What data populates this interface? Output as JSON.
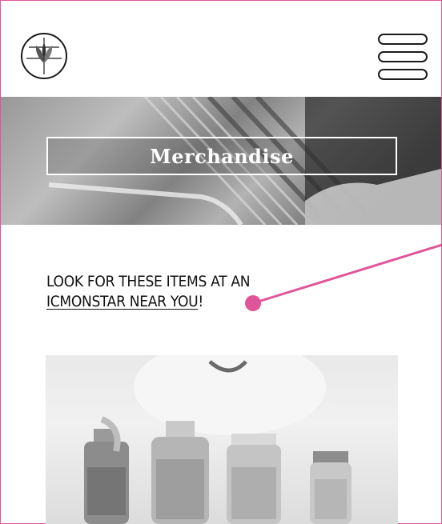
{
  "header": {
    "logo_icon": "tea-leaf-logo-icon",
    "menu_icon": "hamburger-menu-icon"
  },
  "hero": {
    "title": "Merchandise"
  },
  "intro": {
    "line1": "LOOK FOR THESE ITEMS AT AN",
    "link_text": "ICMONSTAR NEAR YOU",
    "suffix": "!"
  },
  "annotation": {
    "color": "#e0559a"
  },
  "photo": {
    "description_icon": "glass-bottles-image"
  }
}
